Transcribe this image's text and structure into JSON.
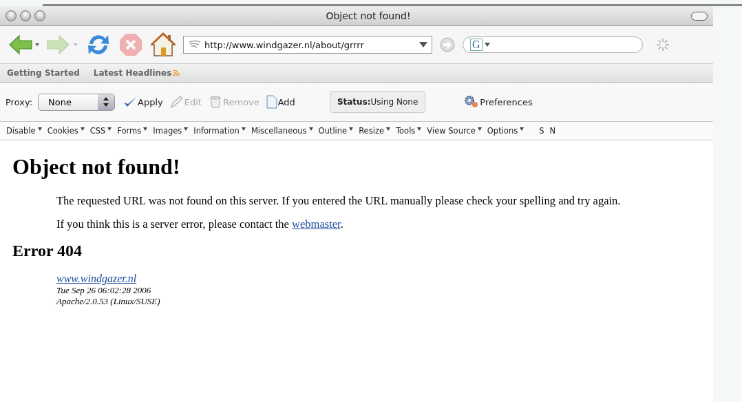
{
  "window": {
    "title": "Object not found!"
  },
  "nav_buttons": [
    {
      "kind": "back",
      "disabled": false
    },
    {
      "kind": "forward",
      "disabled": true
    },
    {
      "kind": "reload",
      "disabled": false
    },
    {
      "kind": "stop",
      "disabled": true
    },
    {
      "kind": "home",
      "disabled": false
    }
  ],
  "address_bar": {
    "value": "http://www.windgazer.nl/about/grrrr"
  },
  "search_field": {
    "engine_letter": "G"
  },
  "bookmarks": [
    {
      "label": "Getting Started",
      "feed": false
    },
    {
      "label": "Latest Headlines",
      "feed": true
    }
  ],
  "proxy_bar": {
    "label": "Proxy:",
    "value": "None",
    "actions": [
      {
        "kind": "apply",
        "label": "Apply",
        "disabled": false
      },
      {
        "kind": "edit",
        "label": "Edit",
        "disabled": true
      },
      {
        "kind": "remove",
        "label": "Remove",
        "disabled": true
      },
      {
        "kind": "add",
        "label": "Add",
        "disabled": false
      }
    ],
    "status_label": "Status:",
    "status_value": "Using None",
    "preferences": "Preferences"
  },
  "dev_toolbar": {
    "menus": [
      "Disable",
      "Cookies",
      "CSS",
      "Forms",
      "Images",
      "Information",
      "Miscellaneous",
      "Outline",
      "Resize",
      "Tools",
      "View Source",
      "Options"
    ],
    "trailing": [
      "S",
      "N"
    ]
  },
  "page": {
    "heading": "Object not found!",
    "paragraph": "The requested URL was not found on this server. If you entered the URL manually please check your spelling and try again.",
    "contact": {
      "before": "If you think this is a server error, please contact the ",
      "link": "webmaster",
      "after": "."
    },
    "error_heading": "Error 404",
    "footer_link": "www.windgazer.nl",
    "footer_lines": [
      "Tue Sep 26 06:02:28 2006",
      "Apache/2.0.53 (Linux/SUSE)"
    ]
  }
}
